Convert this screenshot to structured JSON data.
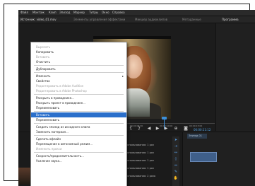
{
  "menubar": {
    "items": [
      "Файл",
      "Монтаж",
      "Клип",
      "Эпизод",
      "Маркер",
      "Титры",
      "Окно",
      "Справка"
    ]
  },
  "panels": {
    "source_tab": "Источник: video_01.mov",
    "tab_2": "Элементы управления эффектами",
    "tab_3": "Микшер аудиоклипов",
    "tab_4": "Метаданные",
    "right_tab": "Программа"
  },
  "viewer": {
    "timecode": "00:00:11:12",
    "ruler_labels": [
      "00:00",
      "00:00:05:00",
      "00:00:10:00",
      "00:00:15:00"
    ]
  },
  "context_menu": {
    "items": [
      {
        "label": "Вырезать",
        "state": "disabled"
      },
      {
        "label": "Копировать",
        "state": "normal"
      },
      {
        "label": "Вставить",
        "state": "disabled"
      },
      {
        "label": "Очистить",
        "state": "normal"
      },
      {
        "sep": true
      },
      {
        "label": "Дублировать",
        "state": "normal"
      },
      {
        "sep": true
      },
      {
        "label": "Изменить",
        "state": "normal",
        "submenu": true
      },
      {
        "label": "Свойства",
        "state": "normal"
      },
      {
        "label": "Редактировать в Adobe Audition",
        "state": "disabled"
      },
      {
        "label": "Редактировать в Adobe Photoshop",
        "state": "disabled"
      },
      {
        "sep": true
      },
      {
        "label": "Раскрыть в проводнике...",
        "state": "normal"
      },
      {
        "label": "Раскрыть проект в проводнике...",
        "state": "normal"
      },
      {
        "label": "Переименовать",
        "state": "normal"
      },
      {
        "sep": true
      },
      {
        "label": "Вставить",
        "state": "highlighted"
      },
      {
        "label": "Переименовать",
        "state": "normal"
      },
      {
        "sep": true
      },
      {
        "label": "Создать эпизод из исходного клипа",
        "state": "normal"
      },
      {
        "label": "Заменить материал...",
        "state": "normal"
      },
      {
        "sep": true
      },
      {
        "label": "Сделать офлайн",
        "state": "normal"
      },
      {
        "label": "Перемещение в автономный режим...",
        "state": "normal"
      },
      {
        "label": "Изменить прокси",
        "state": "disabled"
      },
      {
        "sep": true
      },
      {
        "label": "Скорость/продолжительность...",
        "state": "normal"
      },
      {
        "label": "Усиление звука...",
        "state": "normal"
      }
    ]
  },
  "project": {
    "rows": [
      "Для использования: 1 раз",
      "Для использования: 1 раз",
      "Для использования: 1 раз",
      "Для использования: 1 раз",
      "Для использования: 2 раза"
    ]
  },
  "timeline": {
    "tab_label": "Эпизод 01"
  },
  "colors": {
    "highlight": "#2a6fcb",
    "app_bg": "#1e1e1e",
    "timecode": "#4fa0e0"
  }
}
